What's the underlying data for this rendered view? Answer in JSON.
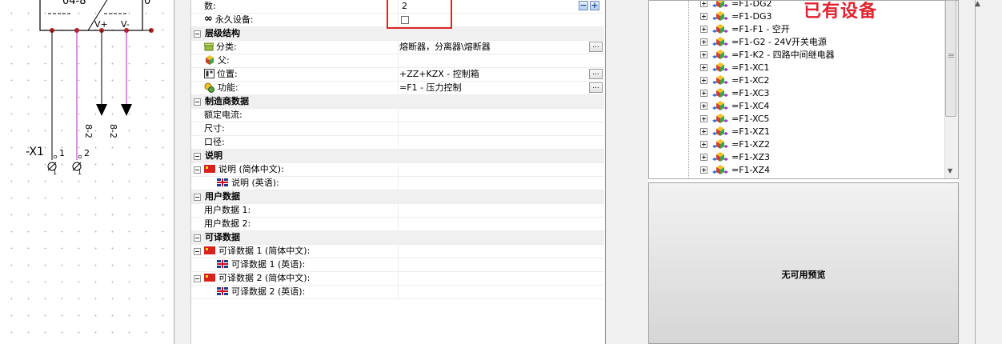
{
  "schematic": {
    "block_label": "04-8",
    "block_corner": "0",
    "pin_plus": "V+",
    "pin_minus": "V-",
    "wire_label_1": "8-2",
    "wire_label_2": "8-2",
    "terminal_name": "-X1",
    "terminal_pin_1": "1",
    "terminal_pin_2": "2",
    "terminal_sub_1": "1",
    "terminal_sub_2": "1",
    "wire_color": "#c020c0"
  },
  "properties": {
    "count_label": "数:",
    "count_value": "2",
    "permanent_label": "永久设备:",
    "sections": {
      "hierarchy": "层级结构",
      "manufacturer": "制造商数据",
      "description": "说明",
      "user_data": "用户数据",
      "translatable": "可译数据"
    },
    "hierarchy": {
      "category_label": "分类:",
      "category_value": "熔断器，分离器\\熔断器",
      "parent_label": "父:",
      "location_label": "位置:",
      "location_value": "+ZZ+KZX - 控制箱",
      "function_label": "功能:",
      "function_value": "=F1 - 压力控制"
    },
    "manufacturer": {
      "rated_current": "额定电流:",
      "size": "尺寸:",
      "caliber": "口径:"
    },
    "description": {
      "zh": "说明 (简体中文):",
      "en": "说明 (英语):"
    },
    "user_data": {
      "field1": "用户数据 1:",
      "field2": "用户数据 2:"
    },
    "translatable": {
      "t1_zh": "可译数据 1 (简体中文):",
      "t1_en": "可译数据 1 (英语):",
      "t2_zh": "可译数据 2 (简体中文):",
      "t2_en": "可译数据 2 (英语):"
    },
    "ellipsis": "...",
    "spin_minus": "−",
    "spin_plus": "+"
  },
  "tree": {
    "items": [
      "=F1-DG2",
      "=F1-DG3",
      "=F1-F1 - 空开",
      "=F1-G2 - 24V开关电源",
      "=F1-K2 - 四路中间继电器",
      "=F1-XC1",
      "=F1-XC2",
      "=F1-XC3",
      "=F1-XC4",
      "=F1-XC5",
      "=F1-XZ1",
      "=F1-XZ2",
      "=F1-XZ3",
      "=F1-XZ4"
    ],
    "annotation": "已有设备"
  },
  "preview": {
    "text": "无可用预览"
  },
  "colors": {
    "highlight": "#e0232e",
    "annotation": "#e0232e",
    "flag_cn": "#d9221c"
  }
}
